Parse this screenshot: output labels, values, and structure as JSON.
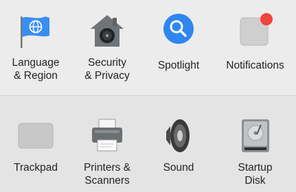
{
  "rows": [
    {
      "items": [
        {
          "label": "Language\n& Region",
          "icon": "flag-globe-icon"
        },
        {
          "label": "Security\n& Privacy",
          "icon": "house-lock-icon"
        },
        {
          "label": "Spotlight",
          "icon": "magnifier-icon"
        },
        {
          "label": "Notifications",
          "icon": "notification-badge-icon"
        }
      ]
    },
    {
      "items": [
        {
          "label": "Trackpad",
          "icon": "trackpad-icon"
        },
        {
          "label": "Printers &\nScanners",
          "icon": "printer-icon"
        },
        {
          "label": "Sound",
          "icon": "speaker-icon"
        },
        {
          "label": "Startup\nDisk",
          "icon": "hard-disk-icon"
        }
      ]
    }
  ],
  "colors": {
    "flag_blue": "#3a8ef0",
    "spotlight_blue": "#2f86f0",
    "notification_red": "#f2453d"
  }
}
